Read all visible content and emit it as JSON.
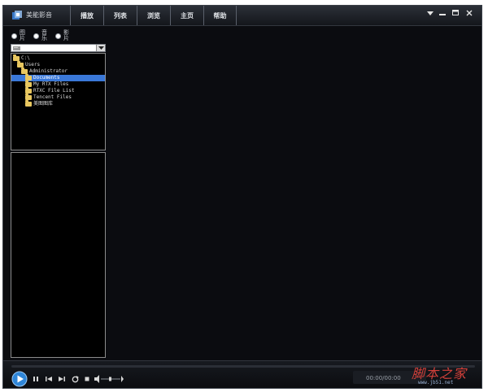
{
  "app": {
    "title": "美能影音"
  },
  "menu": {
    "items": [
      "播放",
      "列表",
      "浏览",
      "主页",
      "帮助"
    ]
  },
  "media_types": [
    {
      "label": "图片",
      "selected": false
    },
    {
      "label": "音乐",
      "selected": false
    },
    {
      "label": "影片",
      "selected": false
    }
  ],
  "drive_select": {
    "value": ""
  },
  "tree": {
    "root": "C:\\",
    "users": "Users",
    "administrator": "Administrator",
    "documents": "Documents",
    "children": [
      "My RTX Files",
      "RTXC File List",
      "Tencent Files",
      "美图图库"
    ]
  },
  "player": {
    "time": "00:00/00:00"
  },
  "watermark": {
    "text": "脚本之家",
    "url": "www.jb51.net"
  },
  "colors": {
    "background": "#0b0c10",
    "selection": "#3a78d8",
    "folder": "#e8c760",
    "play_button": "#2f86d8"
  }
}
